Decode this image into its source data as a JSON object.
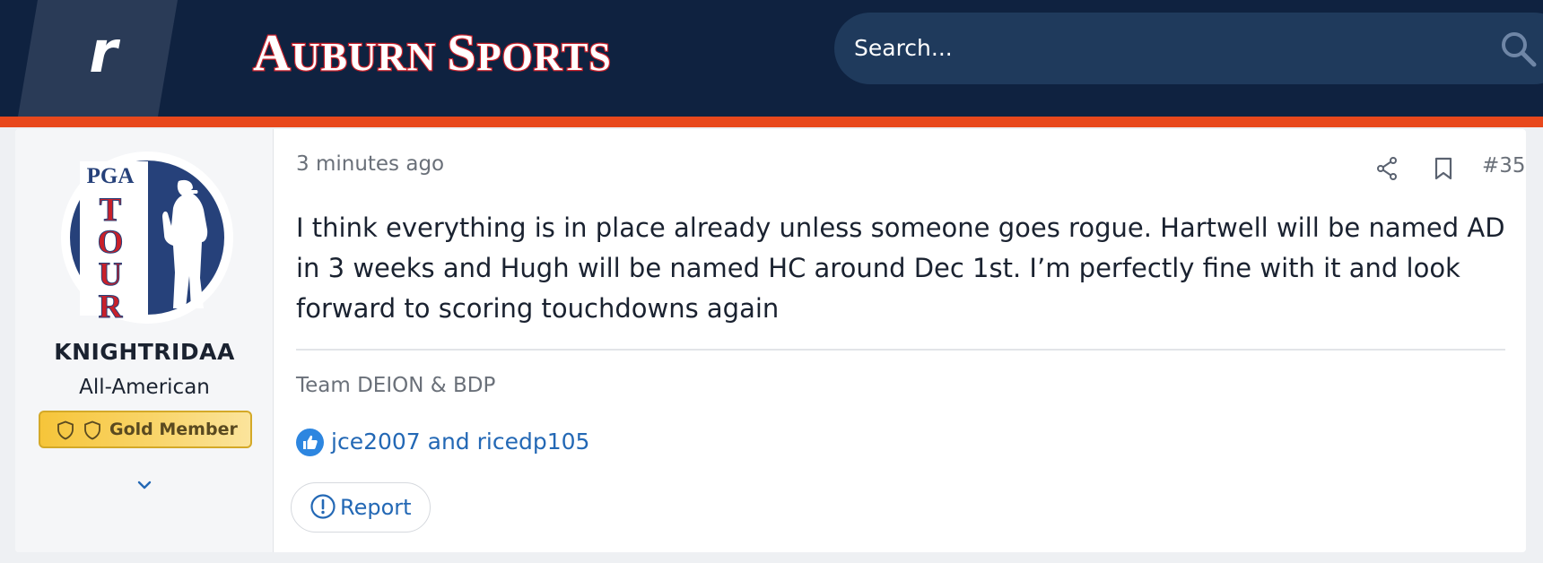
{
  "header": {
    "brand_letter": "r",
    "site_name": "Auburn Sports",
    "site_name_initial_1": "A",
    "site_name_rest_1": "UBURN",
    "site_name_initial_2": "S",
    "site_name_rest_2": "PORTS",
    "search_placeholder": "Search...",
    "colors": {
      "navy": "#0f2240",
      "orange": "#e8481c"
    }
  },
  "post": {
    "user": {
      "avatar_text_top": "PGA",
      "avatar_text_vertical": [
        "T",
        "O",
        "U",
        "R"
      ],
      "username": "KNIGHTRIDAA",
      "title": "All-American",
      "badge": {
        "label": "Gold Member",
        "icon": "shield-icon",
        "color": "#f6c53a"
      },
      "expand_icon": "chevron-down-icon"
    },
    "time": "3 minutes ago",
    "number": "#35",
    "text": "I think everything is in place already unless someone goes rogue. Hartwell will be named AD in 3 weeks and Hugh will be named HC around Dec 1st. I’m perfectly fine with it and look forward to scoring touchdowns again",
    "signature": "Team DEION & BDP",
    "reactions": {
      "icon": "thumbs-up-icon",
      "users": "jce2007 and ricedp105"
    },
    "report_label": "Report",
    "link_color": "#2368b5"
  }
}
